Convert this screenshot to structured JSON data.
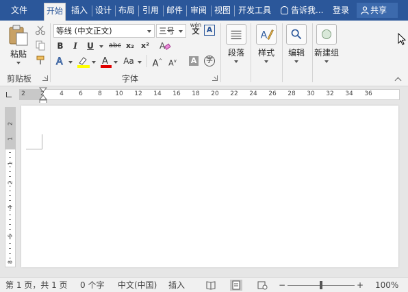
{
  "tabs": [
    {
      "label": "文件",
      "active": false
    },
    {
      "label": "开始",
      "active": true
    },
    {
      "label": "插入",
      "active": false
    },
    {
      "label": "设计",
      "active": false
    },
    {
      "label": "布局",
      "active": false
    },
    {
      "label": "引用",
      "active": false
    },
    {
      "label": "邮件",
      "active": false
    },
    {
      "label": "审阅",
      "active": false
    },
    {
      "label": "视图",
      "active": false
    },
    {
      "label": "开发工具",
      "active": false
    }
  ],
  "tell_me": "告诉我...",
  "login": "登录",
  "share": "共享",
  "clipboard": {
    "paste_label": "粘贴",
    "group_label": "剪贴板"
  },
  "font": {
    "font_name": "等线 (中文正文)",
    "font_size": "三号",
    "phonetic_icon_text": "wén",
    "group_label": "字体",
    "bold": "B",
    "italic": "I",
    "underline": "U",
    "strike": "abc",
    "subscript": "x₂",
    "superscript": "x²",
    "change_case": "Aa",
    "grow": "A",
    "shrink": "A",
    "char_shade": "A",
    "enclose": "字"
  },
  "paragraph": {
    "label": "段落"
  },
  "styles": {
    "label": "样式"
  },
  "editing": {
    "label": "编辑"
  },
  "new_group": {
    "label": "新建组"
  },
  "ruler": {
    "h_numbers": [
      "2",
      "2",
      "4",
      "6",
      "8",
      "10",
      "12",
      "14",
      "16",
      "18",
      "20",
      "22",
      "24",
      "26",
      "28",
      "30",
      "32",
      "34",
      "36"
    ],
    "v_numbers": [
      "2",
      "1",
      "1",
      "2",
      "4",
      "6",
      "8"
    ]
  },
  "status": {
    "page": "第 1 页，共 1 页",
    "words": "0 个字",
    "language": "中文(中国)",
    "mode": "插入",
    "zoom_minus": "−",
    "zoom_plus": "+",
    "zoom": "100%",
    "zoom_level_percent": 100
  },
  "colors": {
    "title_bar": "#2b579a",
    "ribbon": "#f3f3f3",
    "highlight_yellow": "#ffff00",
    "font_red": "#e00000",
    "text_effect_blue": "#2b579a"
  }
}
